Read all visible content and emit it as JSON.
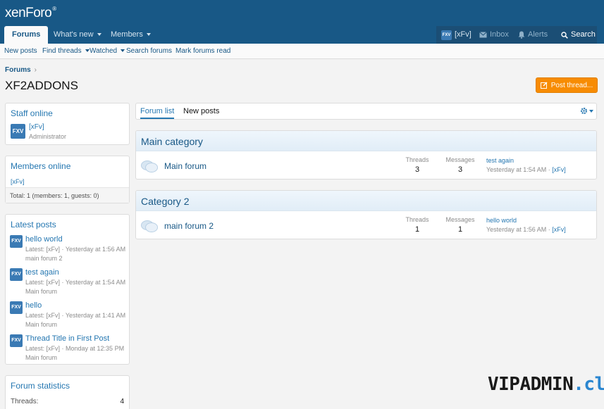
{
  "header": {
    "logo_main": "xenForo",
    "logo_mark": "®",
    "nav": [
      {
        "label": "Forums"
      },
      {
        "label": "What's new"
      },
      {
        "label": "Members"
      }
    ],
    "user": {
      "avatar": "FXV",
      "name": "[xFv]"
    },
    "inbox": "Inbox",
    "alerts": "Alerts",
    "search": "Search"
  },
  "subnav": [
    "New posts",
    "Find threads",
    "Watched",
    "Search forums",
    "Mark forums read"
  ],
  "breadcrumb": "Forums",
  "page_title": "XF2ADDONS",
  "post_thread": "Post thread...",
  "sidebar": {
    "staff": {
      "title": "Staff online",
      "avatar": "FXV",
      "name": "[xFv]",
      "role": "Administrator"
    },
    "members": {
      "title": "Members online",
      "name": "[xFv]",
      "total": "Total: 1 (members: 1, guests: 0)"
    },
    "latest": {
      "title": "Latest posts",
      "items": [
        {
          "title": "hello world",
          "meta": "Latest: [xFv] · Yesterday at 1:56 AM",
          "forum": "main forum 2"
        },
        {
          "title": "test again",
          "meta": "Latest: [xFv] · Yesterday at 1:54 AM",
          "forum": "Main forum"
        },
        {
          "title": "hello",
          "meta": "Latest: [xFv] · Yesterday at 1:41 AM",
          "forum": "Main forum"
        },
        {
          "title": "Thread Title in First Post",
          "meta": "Latest: [xFv] · Monday at 12:35 PM",
          "forum": "Main forum"
        }
      ]
    },
    "stats": {
      "title": "Forum statistics",
      "threads_label": "Threads:",
      "threads_value": "4"
    }
  },
  "tabs": [
    "Forum list",
    "New posts"
  ],
  "categories": [
    {
      "title": "Main category",
      "node": "Main forum",
      "threads_label": "Threads",
      "threads": "3",
      "messages_label": "Messages",
      "messages": "3",
      "last_title": "test again",
      "last_time": "Yesterday at 1:54 AM",
      "last_user": "[xFv]"
    },
    {
      "title": "Category 2",
      "node": "main forum 2",
      "threads_label": "Threads",
      "threads": "1",
      "messages_label": "Messages",
      "messages": "1",
      "last_title": "hello world",
      "last_time": "Yesterday at 1:56 AM",
      "last_user": "[xFv]"
    }
  ],
  "watermark": {
    "part1": "VIPADMIN",
    "part2": ".club"
  },
  "colors": {
    "header": "#185886",
    "accent": "#2577b1",
    "button": "#f78c03"
  }
}
